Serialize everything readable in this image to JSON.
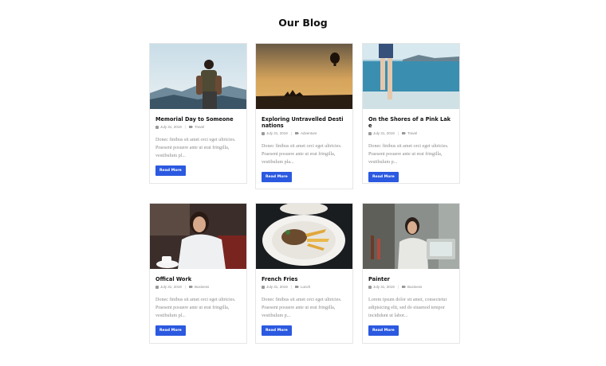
{
  "page": {
    "title": "Our Blog"
  },
  "posts": [
    {
      "title": "Memorial Day to Someone",
      "date": "July 31, 2019",
      "category": "Travel",
      "excerpt": "Donec finibus sit amet orci eget ultricies. Praesent posuere ante ut erat fringilla, vestibulum pl...",
      "button": "Read More"
    },
    {
      "title": "Exploring Untravelled Destinations",
      "date": "July 31, 2019",
      "category": "Adventure",
      "excerpt": "Donec finibus sit amet orci eget ultricies. Praesent posuere ante ut erat fringilla, vestibulum pla...",
      "button": "Read More"
    },
    {
      "title": "On the Shores of a Pink Lake",
      "date": "July 31, 2019",
      "category": "Travel",
      "excerpt": "Donec finibus sit amet orci eget ultricies. Praesent posuere ante ut erat fringilla, vestibulum p...",
      "button": "Read More"
    },
    {
      "title": "Offical Work",
      "date": "July 31, 2019",
      "category": "Business",
      "excerpt": "Donec finibus sit amet orci eget ultricies. Praesent posuere ante ut erat fringilla, vestibulum pl...",
      "button": "Read More"
    },
    {
      "title": "French Fries",
      "date": "July 31, 2019",
      "category": "Lunch",
      "excerpt": "Donec finibus sit amet orci eget ultricies. Praesent posuere ante ut erat fringilla, vestibulum p...",
      "button": "Read More"
    },
    {
      "title": "Painter",
      "date": "July 31, 2019",
      "category": "Business",
      "excerpt": "Lorem ipsum dolor sit amet, consectetur adipisicing elit, sed do eiusmod tempor incididunt ut labor...",
      "button": "Read More"
    }
  ],
  "colors": {
    "button": "#2b59e0",
    "title": "#111111",
    "excerpt": "#8a8a8a"
  },
  "icons": {
    "date": "calendar-icon",
    "category": "tag-icon"
  }
}
